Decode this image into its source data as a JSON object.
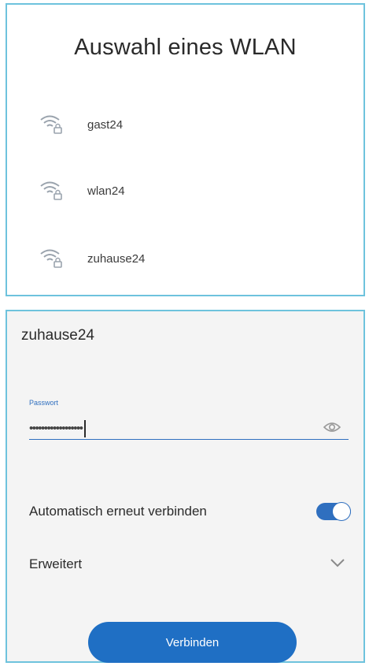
{
  "network_list": {
    "title": "Auswahl eines WLAN",
    "networks": [
      {
        "ssid": "gast24",
        "icon": "wifi-lock-icon"
      },
      {
        "ssid": "wlan24",
        "icon": "wifi-lock-icon"
      },
      {
        "ssid": "zuhause24",
        "icon": "wifi-lock-icon"
      }
    ]
  },
  "connect_dialog": {
    "ssid": "zuhause24",
    "password_label": "Passwort",
    "password_value": "••••••••••••••••••",
    "show_password_icon": "eye-icon",
    "auto_reconnect_label": "Automatisch erneut verbinden",
    "auto_reconnect_enabled": true,
    "advanced_label": "Erweitert",
    "advanced_icon": "chevron-down-icon",
    "connect_button_label": "Verbinden"
  },
  "colors": {
    "accent": "#1f6fc4",
    "frame": "#6ec3dd"
  }
}
